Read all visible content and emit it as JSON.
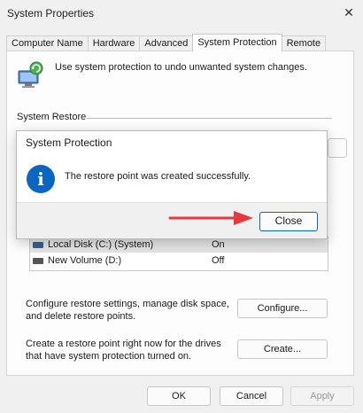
{
  "window": {
    "title": "System Properties"
  },
  "tabs": [
    {
      "label": "Computer Name",
      "active": false
    },
    {
      "label": "Hardware",
      "active": false
    },
    {
      "label": "Advanced",
      "active": false
    },
    {
      "label": "System Protection",
      "active": true
    },
    {
      "label": "Remote",
      "active": false
    }
  ],
  "intro": {
    "text": "Use system protection to undo unwanted system changes."
  },
  "system_restore": {
    "label": "System Restore"
  },
  "drives": [
    {
      "name": "Local Disk (C:) (System)",
      "protection": "On",
      "icon": "system-drive-icon"
    },
    {
      "name": "New Volume (D:)",
      "protection": "Off",
      "icon": "drive-icon"
    }
  ],
  "configure": {
    "description": "Configure restore settings, manage disk space, and delete restore points.",
    "button": "Configure..."
  },
  "create": {
    "description": "Create a restore point right now for the drives that have system protection turned on.",
    "button": "Create..."
  },
  "footer": {
    "ok": "OK",
    "cancel": "Cancel",
    "apply": "Apply"
  },
  "dialog": {
    "title": "System Protection",
    "message": "The restore point was created successfully.",
    "close_button": "Close",
    "icon": "info-icon"
  },
  "colors": {
    "accent": "#0b66c2",
    "arrow": "#e8383b"
  }
}
